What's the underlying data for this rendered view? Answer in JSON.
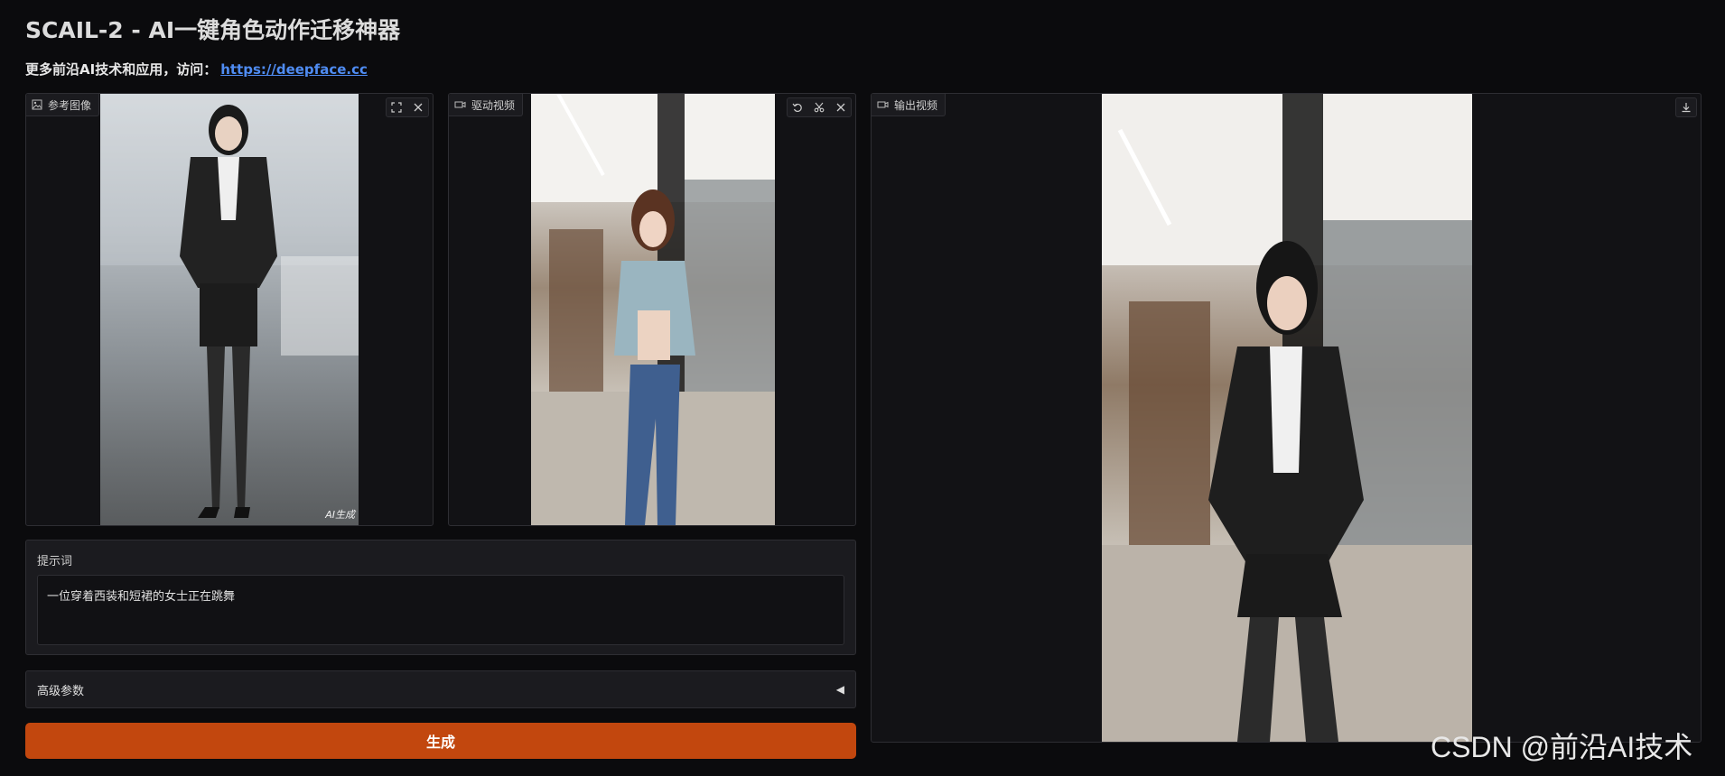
{
  "header": {
    "title": "SCAIL-2 - AI一键角色动作迁移神器",
    "subtitle_prefix": "更多前沿AI技术和应用，访问：",
    "link_text": "https://deepface.cc"
  },
  "reference_panel": {
    "label": "参考图像",
    "icon": "image-icon",
    "tools": [
      "fullscreen-icon",
      "close-icon"
    ],
    "overlay_text": "AI生成"
  },
  "drive_panel": {
    "label": "驱动视频",
    "icon": "video-icon",
    "tools": [
      "undo-icon",
      "scissors-icon",
      "close-icon"
    ]
  },
  "output_panel": {
    "label": "输出视频",
    "icon": "video-icon",
    "tools": [
      "download-icon"
    ]
  },
  "prompt": {
    "label": "提示词",
    "value": "一位穿着西装和短裙的女士正在跳舞"
  },
  "advanced": {
    "label": "高级参数",
    "toggle": "◀"
  },
  "generate_button": {
    "label": "生成"
  },
  "watermark": "CSDN @前沿AI技术",
  "colors": {
    "background": "#0b0b0d",
    "panel": "#121215",
    "accent": "#c2470e",
    "link": "#4f8cf2"
  }
}
